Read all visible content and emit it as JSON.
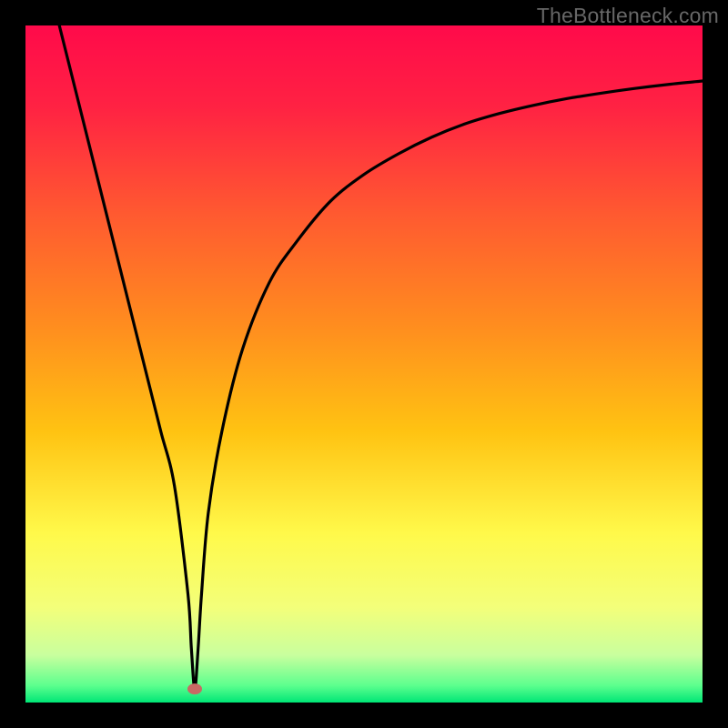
{
  "attribution": "TheBottleneck.com",
  "chart_data": {
    "type": "line",
    "title": "",
    "xlabel": "",
    "ylabel": "",
    "xlim": [
      0,
      100
    ],
    "ylim": [
      0,
      100
    ],
    "x": [
      5,
      8,
      12,
      15,
      18,
      20,
      22,
      24,
      24.5,
      25,
      25.5,
      26,
      27,
      29,
      32,
      36,
      40,
      45,
      50,
      55,
      60,
      65,
      70,
      75,
      80,
      85,
      90,
      95,
      100
    ],
    "values": [
      100,
      88,
      72,
      60,
      48,
      40,
      32,
      16,
      8,
      2,
      8,
      16,
      28,
      40,
      52,
      62,
      68,
      74,
      78,
      81,
      83.5,
      85.5,
      87,
      88.2,
      89.2,
      90,
      90.7,
      91.3,
      91.8
    ],
    "minimum_marker": {
      "x": 25,
      "y": 2
    },
    "gradient_stops": [
      {
        "offset": 0.0,
        "color": "#ff0a4a"
      },
      {
        "offset": 0.12,
        "color": "#ff2243"
      },
      {
        "offset": 0.28,
        "color": "#ff5a30"
      },
      {
        "offset": 0.45,
        "color": "#ff8f1e"
      },
      {
        "offset": 0.6,
        "color": "#ffc312"
      },
      {
        "offset": 0.75,
        "color": "#fff94a"
      },
      {
        "offset": 0.86,
        "color": "#f3ff7a"
      },
      {
        "offset": 0.93,
        "color": "#c9ff9e"
      },
      {
        "offset": 0.975,
        "color": "#5cff8e"
      },
      {
        "offset": 1.0,
        "color": "#00e676"
      }
    ]
  }
}
